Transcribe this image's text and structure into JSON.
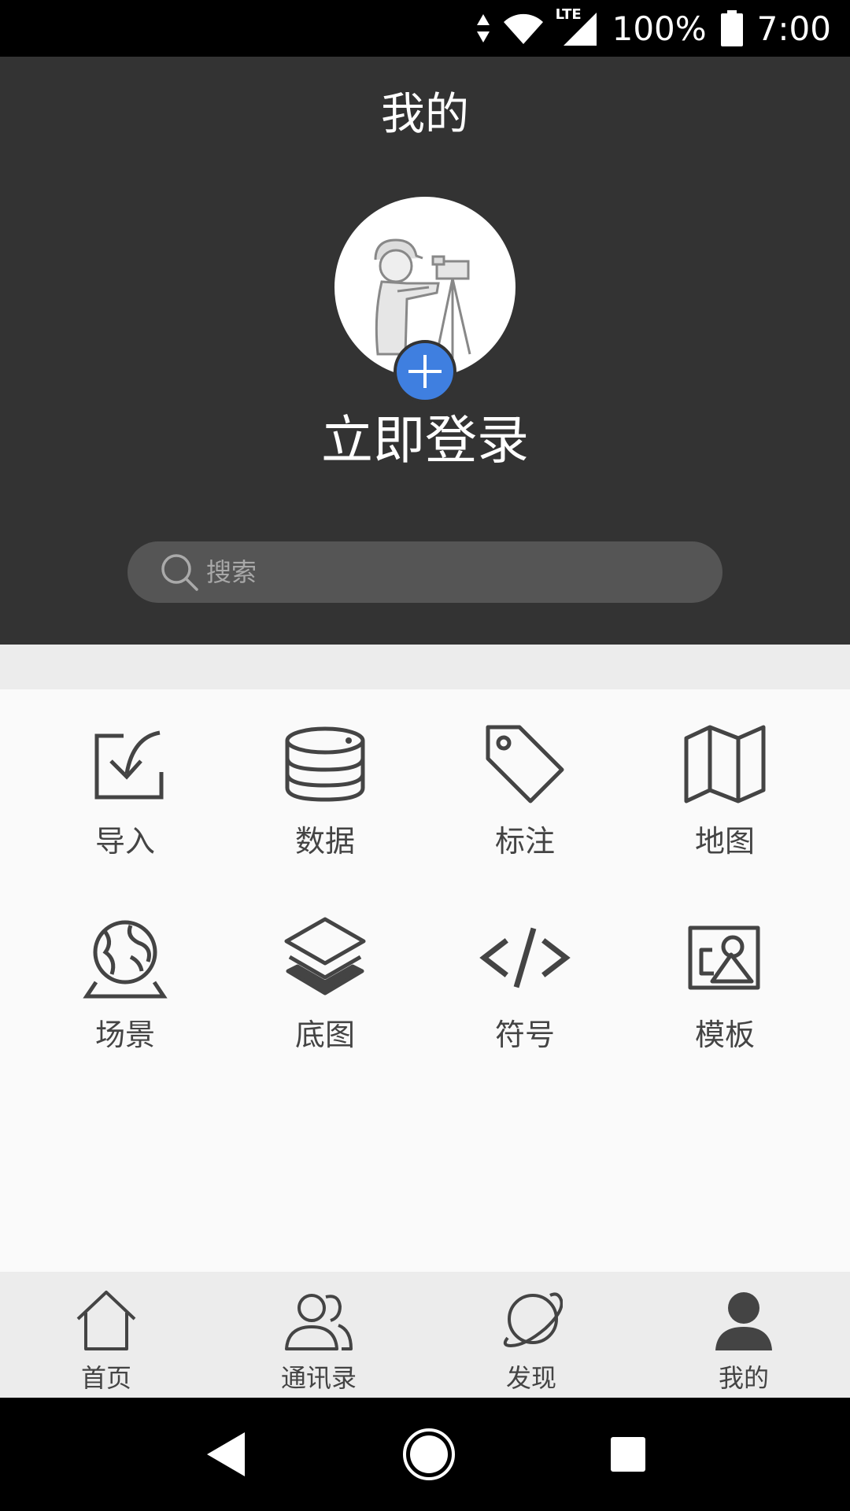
{
  "status_bar": {
    "battery": "100%",
    "time": "7:00",
    "network": "LTE"
  },
  "header": {
    "title": "我的",
    "login_label": "立即登录"
  },
  "search": {
    "placeholder": "搜索"
  },
  "grid": {
    "items": [
      {
        "label": "导入",
        "icon": "import-icon"
      },
      {
        "label": "数据",
        "icon": "database-icon"
      },
      {
        "label": "标注",
        "icon": "tag-icon"
      },
      {
        "label": "地图",
        "icon": "map-icon"
      },
      {
        "label": "场景",
        "icon": "globe-icon"
      },
      {
        "label": "底图",
        "icon": "layers-icon"
      },
      {
        "label": "符号",
        "icon": "code-icon"
      },
      {
        "label": "模板",
        "icon": "image-icon"
      }
    ]
  },
  "bottom_nav": {
    "items": [
      {
        "label": "首页",
        "icon": "home-icon"
      },
      {
        "label": "通讯录",
        "icon": "contacts-icon"
      },
      {
        "label": "发现",
        "icon": "planet-icon"
      },
      {
        "label": "我的",
        "icon": "user-icon"
      }
    ]
  },
  "colors": {
    "header_bg": "#333333",
    "accent": "#3f7fe0",
    "icon": "#444444"
  }
}
